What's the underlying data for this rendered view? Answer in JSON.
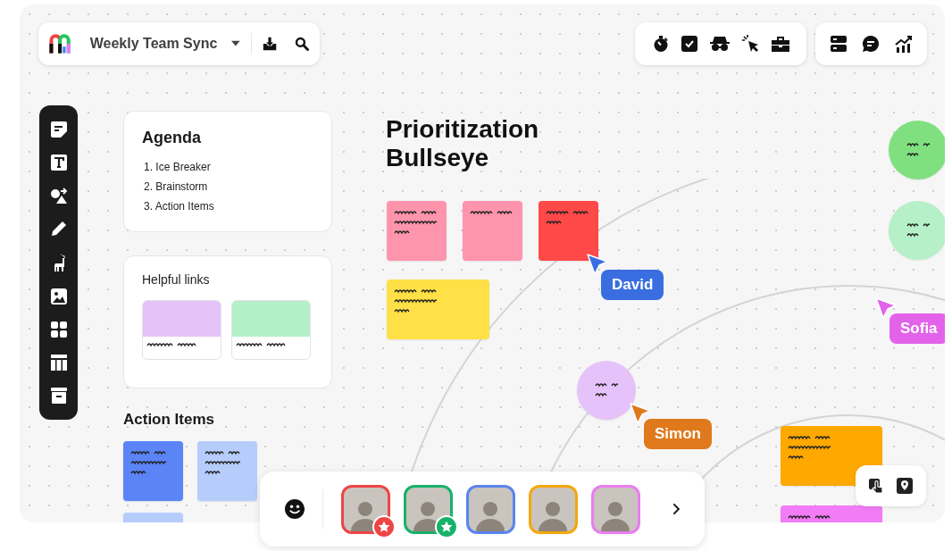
{
  "board": {
    "title": "Weekly Team Sync"
  },
  "agenda": {
    "title": "Agenda",
    "items": [
      "1. Ice Breaker",
      "2. Brainstorm",
      "3. Action Items"
    ]
  },
  "helpful_links": {
    "title": "Helpful links",
    "cards": [
      {
        "color": "#e5c3f9"
      },
      {
        "color": "#b3f0c8"
      }
    ]
  },
  "action_items": {
    "title": "Action Items",
    "stickies": [
      {
        "color": "#5b84f6"
      },
      {
        "color": "#b6cdfc"
      },
      {
        "color": "#b6cdfc"
      }
    ]
  },
  "bullseye": {
    "title": "Prioritization Bullseye",
    "stickies": [
      {
        "kind": "note",
        "color": "#ff94ad"
      },
      {
        "kind": "note",
        "color": "#ff94ad"
      },
      {
        "kind": "note",
        "color": "#ff4848"
      },
      {
        "kind": "note",
        "color": "#ffe046"
      },
      {
        "kind": "circle",
        "color": "#e5c3fa"
      },
      {
        "kind": "circle",
        "color": "#80e080"
      },
      {
        "kind": "circle",
        "color": "#b5f0c8"
      },
      {
        "kind": "note",
        "color": "#ffa800"
      },
      {
        "kind": "note",
        "color": "#f27cf6"
      }
    ]
  },
  "cursors": [
    {
      "name": "David",
      "color": "#3a6ee0"
    },
    {
      "name": "Sofia",
      "color": "#e262ea"
    },
    {
      "name": "Simon",
      "color": "#e0791c"
    }
  ],
  "participants": [
    {
      "color": "#ee4545",
      "starred": true
    },
    {
      "color": "#17b26a",
      "starred": true
    },
    {
      "color": "#5b84f0",
      "starred": false
    },
    {
      "color": "#f5a70a",
      "starred": false
    },
    {
      "color": "#ea7cf0",
      "starred": false
    }
  ]
}
